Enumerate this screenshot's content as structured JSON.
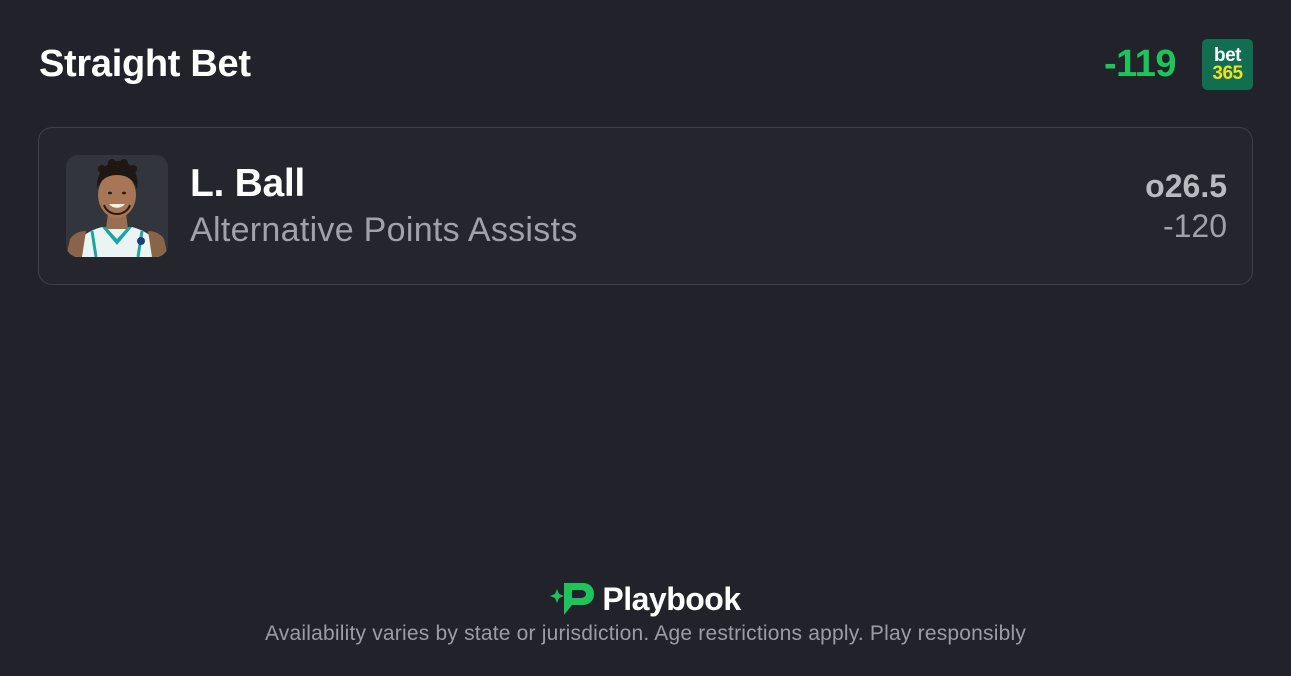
{
  "header": {
    "title": "Straight Bet",
    "total_odds": "-119",
    "book_logo": {
      "line1": "bet",
      "line2": "365"
    }
  },
  "leg": {
    "player_name": "L. Ball",
    "market": "Alternative Points Assists",
    "line": "o26.5",
    "odds": "-120",
    "headshot_icon": "player-headshot"
  },
  "footer": {
    "brand": "Playbook",
    "disclaimer": "Availability varies by state or jurisdiction. Age restrictions apply. Play responsibly"
  },
  "colors": {
    "background": "#22232a",
    "accent_green": "#1ec45b",
    "book_green": "#126e51",
    "book_yellow": "#f4df1e"
  }
}
